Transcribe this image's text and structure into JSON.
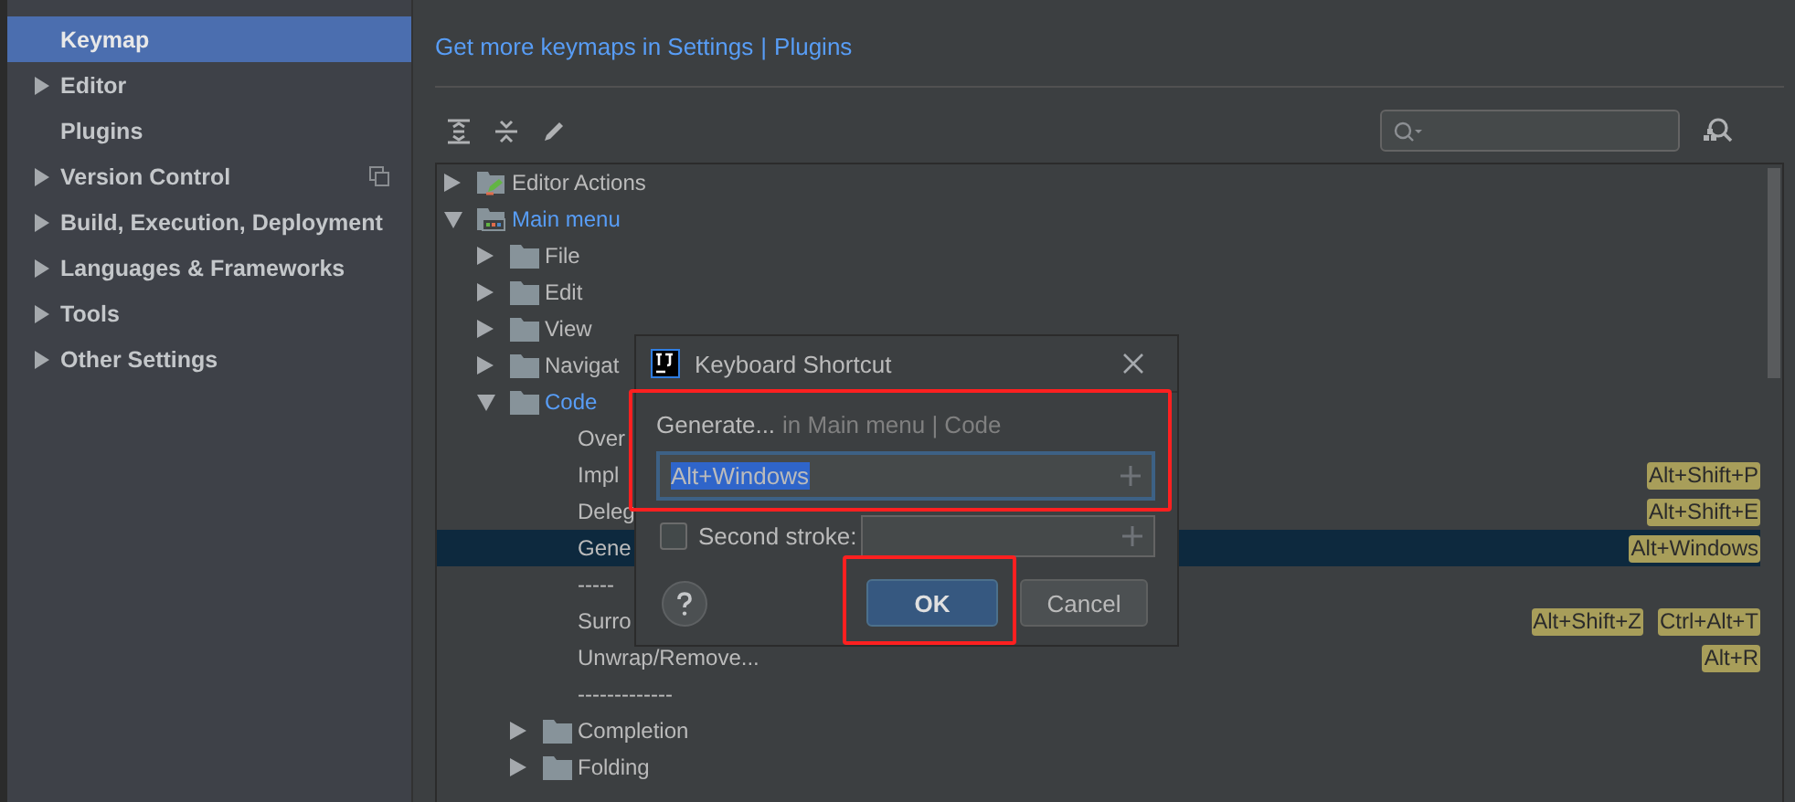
{
  "sidebar": {
    "items": [
      {
        "label": "Keymap",
        "expandable": false,
        "selected": true,
        "project_scoped": false
      },
      {
        "label": "Editor",
        "expandable": true,
        "selected": false,
        "project_scoped": false
      },
      {
        "label": "Plugins",
        "expandable": false,
        "selected": false,
        "project_scoped": false
      },
      {
        "label": "Version Control",
        "expandable": true,
        "selected": false,
        "project_scoped": true
      },
      {
        "label": "Build, Execution, Deployment",
        "expandable": true,
        "selected": false,
        "project_scoped": false
      },
      {
        "label": "Languages & Frameworks",
        "expandable": true,
        "selected": false,
        "project_scoped": false
      },
      {
        "label": "Tools",
        "expandable": true,
        "selected": false,
        "project_scoped": false
      },
      {
        "label": "Other Settings",
        "expandable": true,
        "selected": false,
        "project_scoped": false
      }
    ]
  },
  "keymap_link": {
    "prefix": "Get more keymaps in Settings",
    "separator": "|",
    "link": "Plugins"
  },
  "tree": [
    {
      "label": "Editor Actions",
      "kind": "action-group",
      "expanded": false,
      "modified": false,
      "selected": false
    },
    {
      "label": "Main menu",
      "kind": "menu-group",
      "expanded": true,
      "modified": true,
      "selected": false,
      "children": [
        {
          "label": "File",
          "kind": "folder",
          "expanded": false,
          "modified": false,
          "selected": false
        },
        {
          "label": "Edit",
          "kind": "folder",
          "expanded": false,
          "modified": false,
          "selected": false
        },
        {
          "label": "View",
          "kind": "folder",
          "expanded": false,
          "modified": false,
          "selected": false
        },
        {
          "label": "Navigat",
          "kind": "folder",
          "expanded": false,
          "modified": false,
          "selected": false
        },
        {
          "label": "Code",
          "kind": "folder",
          "expanded": true,
          "modified": true,
          "selected": false,
          "children": [
            {
              "label": "Over",
              "kind": "action",
              "modified": false,
              "selected": false
            },
            {
              "label": "Impl",
              "kind": "action",
              "modified": false,
              "selected": false,
              "shortcuts": [
                "Alt+Shift+P"
              ]
            },
            {
              "label": "Deleg",
              "kind": "action",
              "modified": false,
              "selected": false,
              "shortcuts": [
                "Alt+Shift+E"
              ]
            },
            {
              "label": "Gene",
              "kind": "action",
              "modified": false,
              "selected": true,
              "shortcuts": [
                "Alt+Windows"
              ]
            },
            {
              "label": "-----",
              "kind": "separator",
              "modified": false,
              "selected": false
            },
            {
              "label": "Surro",
              "kind": "action",
              "modified": false,
              "selected": false,
              "shortcuts": [
                "Alt+Shift+Z",
                "Ctrl+Alt+T"
              ]
            },
            {
              "label": "Unwrap/Remove...",
              "kind": "action",
              "modified": false,
              "selected": false,
              "shortcuts": [
                "Alt+R"
              ]
            },
            {
              "label": "-------------",
              "kind": "separator",
              "modified": false,
              "selected": false
            },
            {
              "label": "Completion",
              "kind": "folder",
              "expanded": false,
              "modified": false,
              "selected": false
            },
            {
              "label": "Folding",
              "kind": "folder",
              "expanded": false,
              "modified": false,
              "selected": false
            }
          ]
        }
      ]
    }
  ],
  "dialog": {
    "title": "Keyboard Shortcut",
    "action": "Generate...",
    "context": "in Main menu | Code",
    "highlighted": true,
    "first_stroke": {
      "value": "Alt+Windows",
      "selected_text": true
    },
    "second_stroke": {
      "label": "Second stroke:",
      "checked": false
    },
    "buttons": [
      {
        "label": "OK",
        "kind": "primary",
        "highlighted": true
      },
      {
        "label": "Cancel",
        "kind": "secondary",
        "highlighted": false
      }
    ]
  }
}
